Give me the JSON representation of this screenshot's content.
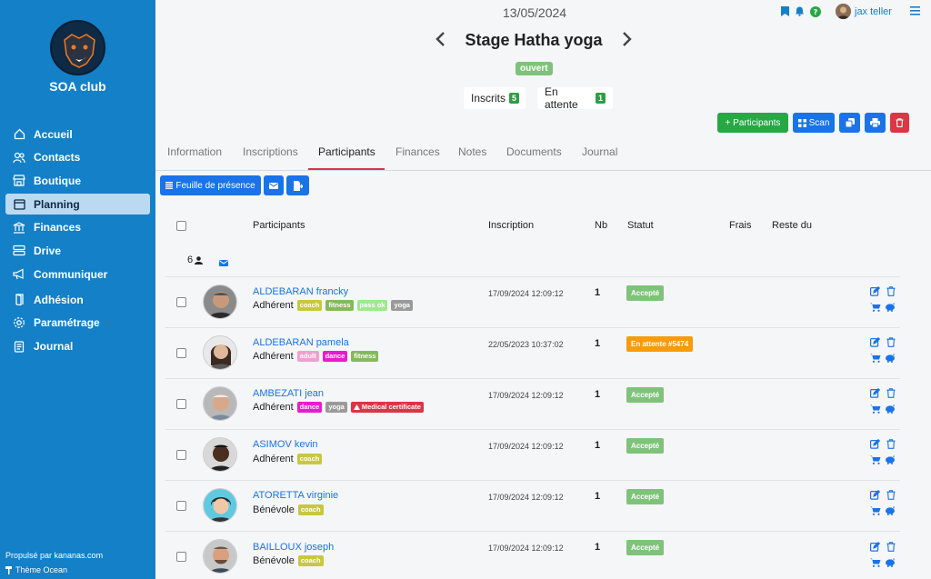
{
  "sidebar": {
    "club_name": "SOA club",
    "items": [
      {
        "label": "Accueil",
        "icon": "home-icon"
      },
      {
        "label": "Contacts",
        "icon": "users-icon"
      },
      {
        "label": "Boutique",
        "icon": "shop-icon"
      },
      {
        "label": "Planning",
        "icon": "calendar-icon",
        "active": true
      },
      {
        "label": "Finances",
        "icon": "bank-icon"
      },
      {
        "label": "Drive",
        "icon": "drive-icon"
      },
      {
        "label": "Communiquer",
        "icon": "megaphone-icon"
      },
      {
        "label": "Adhésion",
        "icon": "door-icon"
      },
      {
        "label": "Paramétrage",
        "icon": "gear-icon"
      },
      {
        "label": "Journal",
        "icon": "journal-icon"
      }
    ],
    "footer_powered": "Propulsé par kananas.com",
    "footer_theme": "Thème Ocean"
  },
  "header": {
    "date": "13/05/2024",
    "title": "Stage Hatha yoga",
    "status": "ouvert",
    "user": "jax teller",
    "inscrits_label": "Inscrits",
    "inscrits_count": "5",
    "attente_label": "En attente",
    "attente_count": "1"
  },
  "actions": {
    "participants": "+ Participants",
    "scan": "Scan"
  },
  "tabs": [
    "Information",
    "Inscriptions",
    "Participants",
    "Finances",
    "Notes",
    "Documents",
    "Journal"
  ],
  "toolbar": {
    "feuille": "Feuille de présence"
  },
  "table": {
    "headers": [
      "Participants",
      "Inscription",
      "Nb",
      "Statut",
      "Frais",
      "Reste du"
    ],
    "count": "6",
    "rows": [
      {
        "name": "ALDEBARAN francky",
        "role": "Adhérent",
        "tags": [
          "coach",
          "fitness",
          "pass ok",
          "yoga"
        ],
        "date": "17/09/2024 12:09:12",
        "nb": "1",
        "status": "Accepté"
      },
      {
        "name": "ALDEBARAN pamela",
        "role": "Adhérent",
        "tags": [
          "adult",
          "dance",
          "fitness"
        ],
        "date": "22/05/2023 10:37:02",
        "nb": "1",
        "status": "En attente #5474"
      },
      {
        "name": "AMBEZATI jean",
        "role": "Adhérent",
        "tags": [
          "dance",
          "yoga",
          "Medical certificate"
        ],
        "date": "17/09/2024 12:09:12",
        "nb": "1",
        "status": "Accepté"
      },
      {
        "name": "ASIMOV kevin",
        "role": "Adhérent",
        "tags": [
          "coach"
        ],
        "date": "17/09/2024 12:09:12",
        "nb": "1",
        "status": "Accepté"
      },
      {
        "name": "ATORETTA virginie",
        "role": "Bénévole",
        "tags": [
          "coach"
        ],
        "date": "17/09/2024 12:09:12",
        "nb": "1",
        "status": "Accepté"
      },
      {
        "name": "BAILLOUX joseph",
        "role": "Bénévole",
        "tags": [
          "coach"
        ],
        "date": "17/09/2024 12:09:12",
        "nb": "1",
        "status": "Accepté"
      }
    ]
  },
  "colors": {
    "sidebar": "#1480c8",
    "accent_blue": "#1a73e8",
    "green": "#28a745",
    "red": "#dc3545",
    "wait_orange": "#f89b0c"
  }
}
